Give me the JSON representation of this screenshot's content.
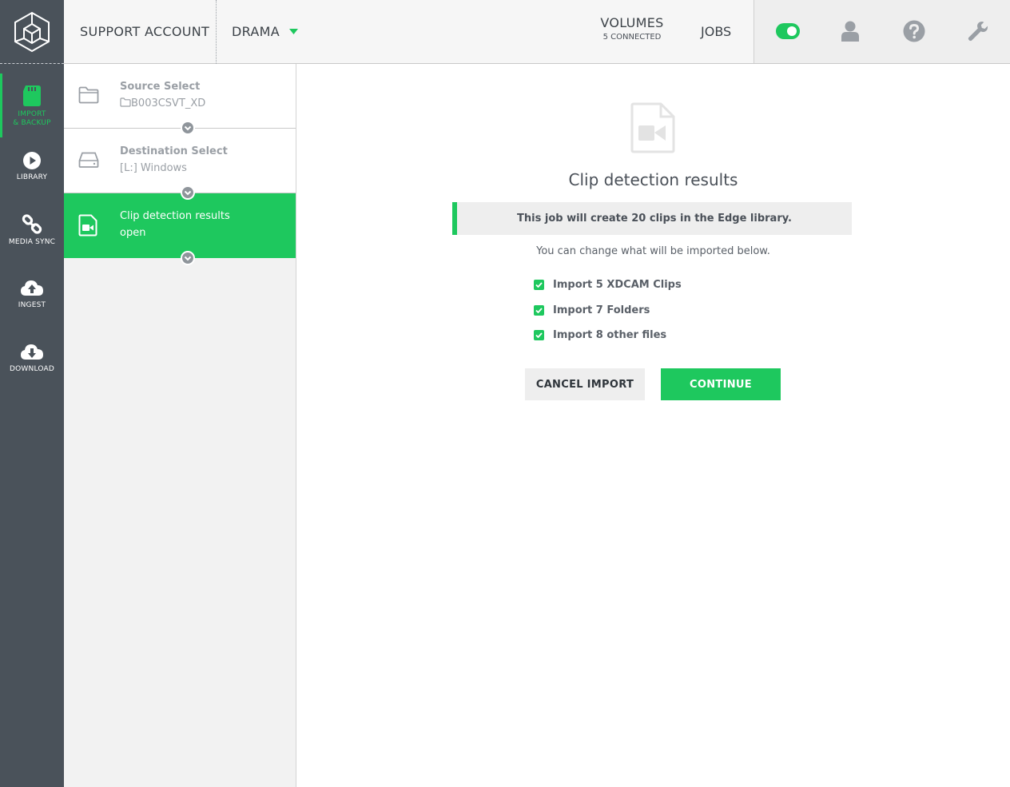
{
  "topbar": {
    "account": "SUPPORT ACCOUNT",
    "project": "DRAMA",
    "volumes": {
      "title": "VOLUMES",
      "subtitle": "5 CONNECTED"
    },
    "jobs": "JOBS",
    "toggle_on": true
  },
  "sidebar": {
    "items": [
      {
        "label_line1": "IMPORT",
        "label_line2": "& BACKUP",
        "icon": "sd-card-icon",
        "active": true
      },
      {
        "label": "LIBRARY",
        "icon": "play-circle-icon"
      },
      {
        "label": "MEDIA SYNC",
        "icon": "link-icon"
      },
      {
        "label": "INGEST",
        "icon": "cloud-upload-icon"
      },
      {
        "label": "DOWNLOAD",
        "icon": "cloud-download-icon"
      }
    ]
  },
  "steps": [
    {
      "title": "Source Select",
      "subtitle": "B003CSVT_XD",
      "icon": "folder-icon"
    },
    {
      "title": "Destination Select",
      "subtitle": "[L:] Windows",
      "icon": "drive-icon"
    },
    {
      "title": "Clip detection results",
      "subtitle": "open",
      "icon": "video-file-icon",
      "active": true
    }
  ],
  "main": {
    "title": "Clip detection results",
    "info": "This job will create 20 clips in the Edge library.",
    "hint": "You can change what will be imported below.",
    "options": [
      {
        "label": "Import 5 XDCAM Clips",
        "checked": true
      },
      {
        "label": "Import 7 Folders",
        "checked": true
      },
      {
        "label": "Import 8 other files",
        "checked": true
      }
    ],
    "cancel_label": "CANCEL IMPORT",
    "continue_label": "CONTINUE"
  },
  "colors": {
    "accent": "#1ec85e",
    "rail": "#4a525a"
  }
}
